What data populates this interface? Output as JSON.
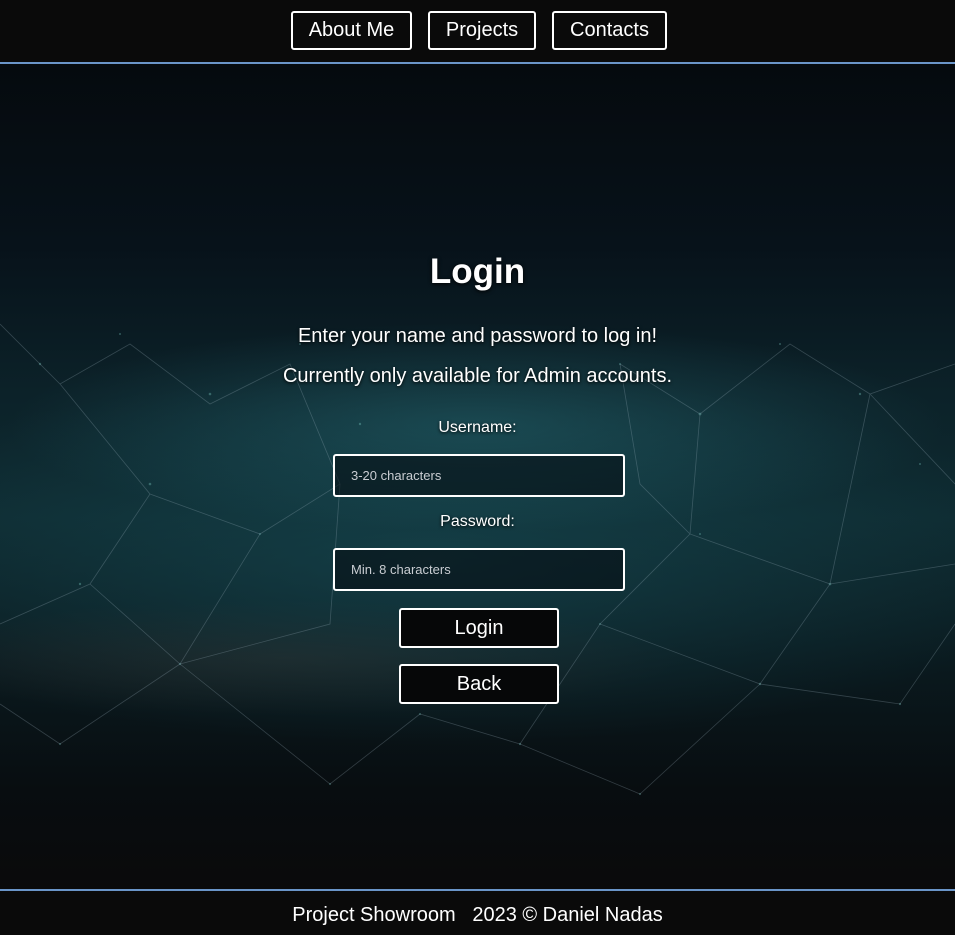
{
  "nav": {
    "items": [
      {
        "label": "About Me"
      },
      {
        "label": "Projects"
      },
      {
        "label": "Contacts"
      }
    ]
  },
  "login": {
    "title": "Login",
    "lead_1": "Enter your name and password to log in!",
    "lead_2": "Currently only available for Admin accounts.",
    "username_label": "Username:",
    "username_placeholder": "3-20 characters",
    "password_label": "Password:",
    "password_placeholder": "Min. 8 characters",
    "login_button": "Login",
    "back_button": "Back"
  },
  "footer": {
    "site_name": "Project Showroom",
    "copyright": "2023 © Daniel Nadas"
  },
  "colors": {
    "accent_border": "#6a95c8",
    "background": "#0a0a0a",
    "text": "#ffffff"
  },
  "icons": {
    "background": "city-network-night-image"
  }
}
